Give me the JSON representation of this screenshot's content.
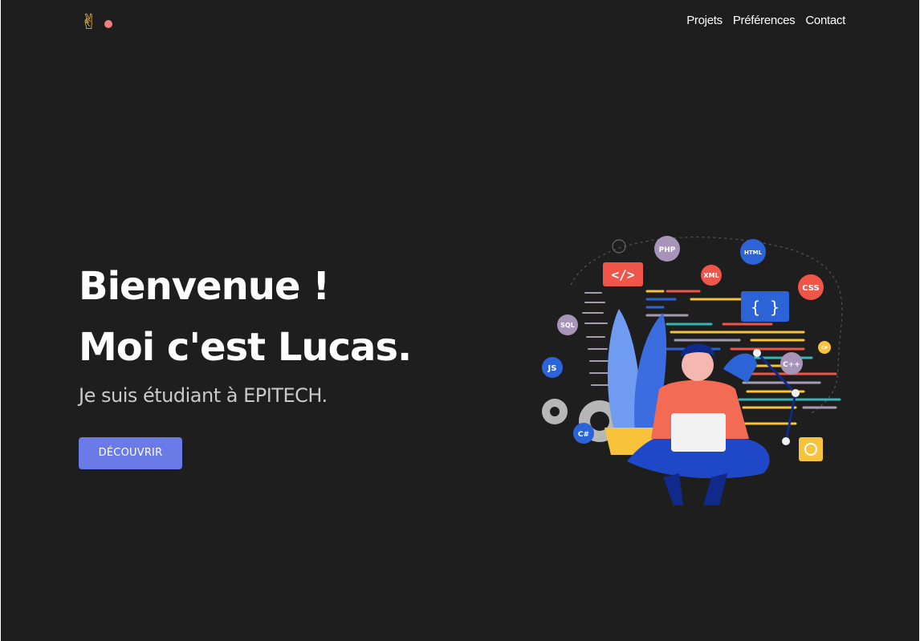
{
  "theme": {
    "background": "#1e1e1e",
    "accent": "#6a7ae6",
    "logo_dot": "#f07f7f"
  },
  "header": {
    "logo_icon": "victory-hand-icon",
    "logo_glyph": "✌"
  },
  "nav": {
    "items": [
      {
        "label": "Projets"
      },
      {
        "label": "Préférences"
      },
      {
        "label": "Contact"
      }
    ]
  },
  "hero": {
    "title_line1": "Bienvenue !",
    "title_line2": "Moi c'est Lucas.",
    "subtitle": "Je suis étudiant à EPITECH.",
    "cta_label": "DÉCOUVRIR"
  },
  "illustration": {
    "badges": {
      "php": "PHP",
      "xml": "XML",
      "html": "HTML",
      "css": "CSS",
      "sql": "SQL",
      "js": "JS",
      "cpp": "C++",
      "cs": "C#",
      "csmall": "C#"
    },
    "code_tag": "</>",
    "braces": "{ }"
  }
}
